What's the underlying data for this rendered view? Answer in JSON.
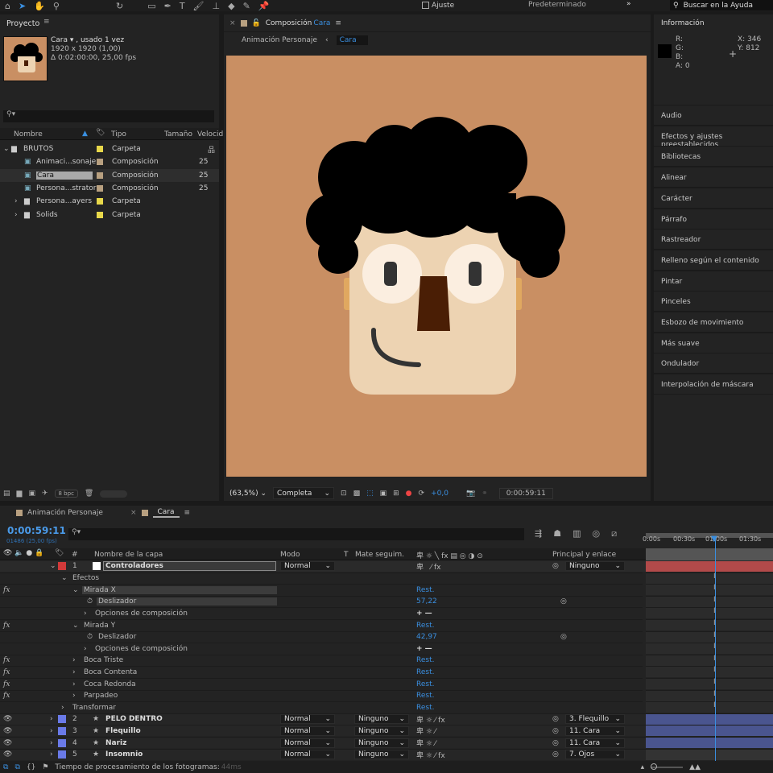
{
  "toolbar": {
    "snap_label": "Ajuste",
    "workspace": "Predeterminado",
    "help_placeholder": "Buscar en la Ayuda",
    "icons": [
      "home-icon",
      "selection-icon",
      "hand-icon",
      "zoom-icon",
      "rotate-icon",
      "pen-icon",
      "text-icon",
      "brush-icon",
      "stamp-icon",
      "eraser-icon",
      "puppet-icon"
    ]
  },
  "project": {
    "title": "Proyecto",
    "item_name": "Cara ▾ , usado 1 vez",
    "item_size": "1920 x 1920 (1,00)",
    "item_duration": "Δ 0:02:00:00, 25,00 fps",
    "columns": [
      "Nombre",
      "Tipo",
      "Tamaño",
      "Velocid"
    ],
    "items": [
      {
        "name": "BRUTOS",
        "type": "Carpeta",
        "speed": "",
        "kind": "folder",
        "color": "#e8d84a"
      },
      {
        "name": "Animaci...sonaje",
        "type": "Composición",
        "speed": "25",
        "kind": "comp",
        "color": "#b8a080"
      },
      {
        "name": "Cara",
        "type": "Composición",
        "speed": "25",
        "kind": "comp",
        "color": "#b8a080"
      },
      {
        "name": "Persona...strator",
        "type": "Composición",
        "speed": "25",
        "kind": "comp",
        "color": "#b8a080"
      },
      {
        "name": "Persona...ayers",
        "type": "Carpeta",
        "speed": "",
        "kind": "folder",
        "color": "#e8d84a"
      },
      {
        "name": "Solids",
        "type": "Carpeta",
        "speed": "",
        "kind": "folder",
        "color": "#e8d84a"
      }
    ],
    "bpc": "8 bpc"
  },
  "comp": {
    "tab_prefix": "Composición",
    "tab_name": "Cara",
    "breadcrumb_parent": "Animación Personaje",
    "breadcrumb_current": "Cara",
    "zoom": "(63,5%)",
    "resolution": "Completa",
    "exposure": "+0,0",
    "timecode": "0:00:59:11",
    "bg_color": "#c98f63"
  },
  "info": {
    "title": "Información",
    "r": "R:",
    "g": "G:",
    "b": "B:",
    "a": "A:",
    "a_val": "0",
    "x": "X:",
    "x_val": "346",
    "y": "Y:",
    "y_val": "812"
  },
  "right_panels": [
    "Audio",
    "Efectos y ajustes preestablecidos",
    "Bibliotecas",
    "Alinear",
    "Carácter",
    "Párrafo",
    "Rastreador",
    "Relleno según el contenido",
    "Pintar",
    "Pinceles",
    "Esbozo de movimiento",
    "Más suave",
    "Ondulador",
    "Interpolación de máscara"
  ],
  "timeline": {
    "tabs": [
      "Animación Personaje",
      "Cara"
    ],
    "timecode": "0:00:59:11",
    "frame_info": "01486 (25,00 fps)",
    "columns": {
      "num": "#",
      "name": "Nombre de la capa",
      "mode": "Modo",
      "t": "T",
      "matte": "Mate seguim.",
      "parent": "Principal y enlace"
    },
    "ruler": [
      "0:00s",
      "00:30s",
      "01:00s",
      "01:30s"
    ],
    "layer1": {
      "num": "1",
      "name": "Controladores",
      "mode": "Normal",
      "parent": "Ninguno",
      "color": "#d23a3a"
    },
    "props": [
      {
        "label": "Efectos",
        "indent": 1,
        "arrow": "v"
      },
      {
        "label": "Mirada X",
        "indent": 2,
        "arrow": "v",
        "fx": true,
        "value": "Rest.",
        "hl": true
      },
      {
        "label": "Deslizador",
        "indent": 3,
        "stopwatch": true,
        "value": "57,22",
        "spiral": true,
        "hl": true
      },
      {
        "label": "Opciones de composición",
        "indent": 3,
        "arrow": ">",
        "value": "+ —"
      },
      {
        "label": "Mirada Y",
        "indent": 2,
        "arrow": "v",
        "fx": true,
        "value": "Rest."
      },
      {
        "label": "Deslizador",
        "indent": 3,
        "stopwatch": true,
        "value": "42,97",
        "spiral": true
      },
      {
        "label": "Opciones de composición",
        "indent": 3,
        "arrow": ">",
        "value": "+ —"
      },
      {
        "label": "Boca Triste",
        "indent": 2,
        "arrow": ">",
        "fx": true,
        "value": "Rest."
      },
      {
        "label": "Boca Contenta",
        "indent": 2,
        "arrow": ">",
        "fx": true,
        "value": "Rest."
      },
      {
        "label": "Coca Redonda",
        "indent": 2,
        "arrow": ">",
        "fx": true,
        "value": "Rest."
      },
      {
        "label": "Parpadeo",
        "indent": 2,
        "arrow": ">",
        "fx": true,
        "value": "Rest."
      },
      {
        "label": "Transformar",
        "indent": 1,
        "arrow": ">",
        "value": "Rest."
      }
    ],
    "layers": [
      {
        "num": "2",
        "name": "PELO DENTRO",
        "mode": "Normal",
        "matte": "Ninguno",
        "parent": "3. Flequillo",
        "color": "#6a7ae8"
      },
      {
        "num": "3",
        "name": "Flequillo",
        "mode": "Normal",
        "matte": "Ninguno",
        "parent": "11. Cara",
        "color": "#6a7ae8"
      },
      {
        "num": "4",
        "name": "Nariz",
        "mode": "Normal",
        "matte": "Ninguno",
        "parent": "11. Cara",
        "color": "#6a7ae8"
      },
      {
        "num": "5",
        "name": "Insomnio",
        "mode": "Normal",
        "matte": "Ninguno",
        "parent": "7. Ojos",
        "color": "#6a7ae8"
      }
    ],
    "status": "Tiempo de procesamiento de los fotogramas:",
    "status_val": "44ms"
  }
}
